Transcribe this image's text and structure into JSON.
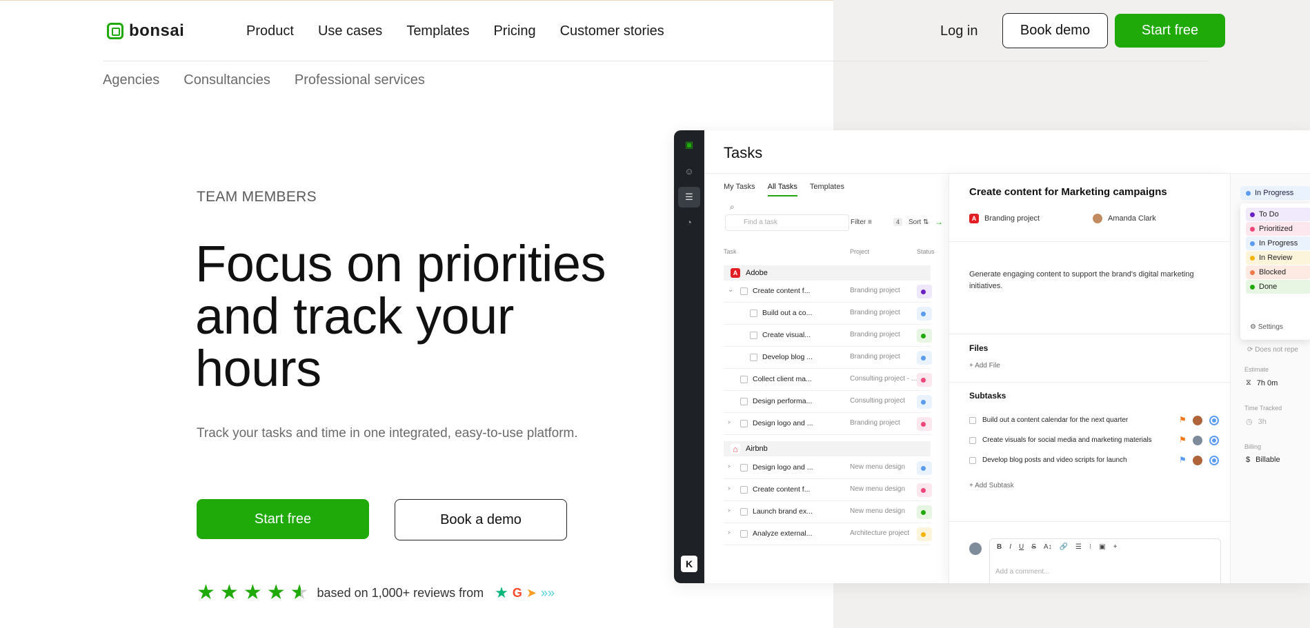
{
  "brand": {
    "name": "bonsai",
    "accent": "#1faa0a"
  },
  "nav": {
    "items": [
      "Product",
      "Use cases",
      "Templates",
      "Pricing",
      "Customer stories"
    ],
    "login": "Log in",
    "book_demo": "Book demo",
    "start_free": "Start free"
  },
  "subnav": [
    "Agencies",
    "Consultancies",
    "Professional services"
  ],
  "hero": {
    "eyebrow": "TEAM MEMBERS",
    "headline": "Focus on priorities and track your hours",
    "sub": "Track your tasks and time in one integrated, easy-to-use platform.",
    "cta_primary": "Start free",
    "cta_secondary": "Book a demo",
    "reviews_text": "based on 1,000+ reviews from",
    "rating_stars": 4.5
  },
  "app": {
    "title": "Tasks",
    "tabs": [
      "My Tasks",
      "All Tasks",
      "Templates"
    ],
    "active_tab": "All Tasks",
    "search_placeholder": "Find a task",
    "filter_label": "Filter",
    "sort_label": "Sort",
    "filter_count": "4",
    "columns": [
      "Task",
      "Project",
      "Status"
    ],
    "groups": [
      {
        "name": "Adobe",
        "badge": "A",
        "color": "#e01e24"
      },
      {
        "name": "Airbnb",
        "badge": "A",
        "color": "#ff5a5f"
      }
    ],
    "rows": [
      {
        "name": "Create content f...",
        "project": "Branding project",
        "status_color": "#6b21c8",
        "status_bg": "#efe7fb",
        "level": 0,
        "expander": "⌄"
      },
      {
        "name": "Build out a co...",
        "project": "Branding project",
        "status_color": "#5b9cf0",
        "status_bg": "#eaf2fd",
        "level": 1,
        "expander": ""
      },
      {
        "name": "Create visual...",
        "project": "Branding project",
        "status_color": "#1faa0a",
        "status_bg": "#e6f6e2",
        "level": 1,
        "expander": ""
      },
      {
        "name": "Develop blog ...",
        "project": "Branding project",
        "status_color": "#5b9cf0",
        "status_bg": "#eaf2fd",
        "level": 1,
        "expander": ""
      },
      {
        "name": "Collect client ma...",
        "project": "Consulting project - ...",
        "status_color": "#f0457a",
        "status_bg": "#fde7ee",
        "level": 0,
        "expander": ""
      },
      {
        "name": "Design performa...",
        "project": "Consulting project",
        "status_color": "#5b9cf0",
        "status_bg": "#eaf2fd",
        "level": 0,
        "expander": ""
      },
      {
        "name": "Design logo and ...",
        "project": "Branding project",
        "status_color": "#f0457a",
        "status_bg": "#fde7ee",
        "level": 0,
        "expander": "›"
      },
      {
        "name": "Design logo and ...",
        "project": "New menu design",
        "status_color": "#5b9cf0",
        "status_bg": "#eaf2fd",
        "level": 0,
        "expander": "›"
      },
      {
        "name": "Create content f...",
        "project": "New menu design",
        "status_color": "#f0457a",
        "status_bg": "#fde7ee",
        "level": 0,
        "expander": "›"
      },
      {
        "name": "Launch brand ex...",
        "project": "New menu design",
        "status_color": "#1faa0a",
        "status_bg": "#e6f6e2",
        "level": 0,
        "expander": "›"
      },
      {
        "name": "Analyze external...",
        "project": "Architecture project",
        "status_color": "#f5b50a",
        "status_bg": "#fdf4dc",
        "level": 0,
        "expander": "›"
      }
    ],
    "detail": {
      "title": "Create content for Marketing campaigns",
      "project": "Branding project",
      "assignee": "Amanda Clark",
      "description": "Generate engaging content to support the brand's digital marketing initiatives.",
      "files_heading": "Files",
      "add_file": "+ Add File",
      "subtasks_heading": "Subtasks",
      "subtasks": [
        {
          "text": "Build out a content calendar for the next quarter",
          "flag_color": "#f07a1a"
        },
        {
          "text": "Create visuals for social media and marketing materials",
          "flag_color": "#f07a1a"
        },
        {
          "text": "Develop blog posts and video scripts for launch",
          "flag_color": "#5b9cf0"
        }
      ],
      "add_subtask": "+ Add Subtask",
      "toolbar": [
        "B",
        "I",
        "U",
        "S",
        "A↕",
        "🔗",
        "☰",
        "⁝",
        "▣",
        "+"
      ],
      "comment_placeholder": "Add a comment..."
    },
    "status": {
      "current": "In Progress",
      "options": [
        {
          "label": "To Do",
          "color": "#6b21c8",
          "bg": "#f1eafc"
        },
        {
          "label": "Prioritized",
          "color": "#f0457a",
          "bg": "#fde7ee"
        },
        {
          "label": "In Progress",
          "color": "#5b9cf0",
          "bg": "#eaf2fd"
        },
        {
          "label": "In Review",
          "color": "#f5b50a",
          "bg": "#fdf4dc"
        },
        {
          "label": "Blocked",
          "color": "#f07a4a",
          "bg": "#fdebe3"
        },
        {
          "label": "Done",
          "color": "#1faa0a",
          "bg": "#e6f6e2"
        }
      ],
      "settings": "Settings",
      "repeat": "Does not repe",
      "estimate_label": "Estimate",
      "estimate_value": "7h 0m",
      "tracked_label": "Time Tracked",
      "tracked_value": "3h",
      "billing_label": "Billing",
      "billing_value": "Billable"
    }
  }
}
